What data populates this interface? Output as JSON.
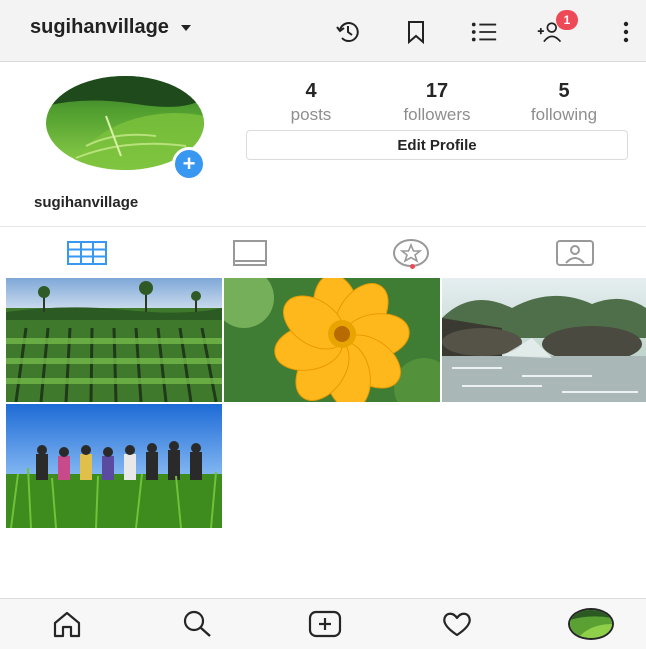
{
  "header": {
    "username": "sugihanvillage",
    "notification_count": "1"
  },
  "profile": {
    "stats": [
      {
        "value": "4",
        "label": "posts"
      },
      {
        "value": "17",
        "label": "followers"
      },
      {
        "value": "5",
        "label": "following"
      }
    ],
    "edit_label": "Edit Profile",
    "name": "sugihanvillage"
  },
  "tabs": [
    "grid-icon",
    "feed-icon",
    "saved-star-icon",
    "tagged-user-icon"
  ],
  "posts": [
    {
      "subject": "rice field landscape"
    },
    {
      "subject": "yellow flower"
    },
    {
      "subject": "river with rocks"
    },
    {
      "subject": "group in rice field"
    }
  ],
  "bottom_nav": [
    "home-icon",
    "search-icon",
    "add-post-icon",
    "activity-heart-icon",
    "profile-avatar"
  ],
  "colors": {
    "accent_blue": "#3897f0",
    "badge_red": "#ed4956",
    "grid_icon_blue": "#3897f0"
  }
}
